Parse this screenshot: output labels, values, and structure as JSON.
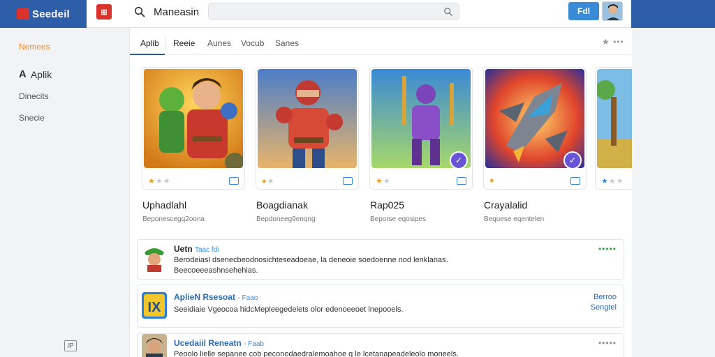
{
  "brand": {
    "name": "Seedeil"
  },
  "header": {
    "app_icon_text": "⊞",
    "title": "Maneasin",
    "search_placeholder": "",
    "button_label": "Fdl"
  },
  "sidebar": {
    "items": [
      {
        "label": "Nemees",
        "active": true
      },
      {
        "label": "Aplik",
        "glyph": "A"
      },
      {
        "label": "Dinecits"
      },
      {
        "label": "Snecie"
      }
    ]
  },
  "tabs": [
    "Aplib",
    "Reeie",
    "Aunes",
    "Vocub",
    "Sanes"
  ],
  "tabs_more": "★ •••",
  "cards": [
    {
      "title": "Uphadlahl",
      "subtitle": "Beponescegq2oona",
      "rating": 1,
      "badge": false
    },
    {
      "title": "Boagdianak",
      "subtitle": "Bepdoneeg9enqng",
      "rating": 1,
      "badge": false
    },
    {
      "title": "Rap025",
      "subtitle": "Beporse eqosipes",
      "rating": 1,
      "badge": true
    },
    {
      "title": "Crayalalid",
      "subtitle": "Bequese eqentelen",
      "rating": 1,
      "badge": true
    },
    {
      "title": "",
      "subtitle": "",
      "rating": 1,
      "badge": false
    }
  ],
  "rows": [
    {
      "title": "Uetn",
      "tag": "Taac fdi",
      "desc": "Berodeiasl dsenecbeodnosichteseadoeae, la deneoie soedoenne nod lenklanas. Beecoeeeashnsehehias.",
      "dots": "•••••"
    },
    {
      "title": "AplieN Rsesoat",
      "tag": "- Faao",
      "desc": "Seeidiaie Vgeocoa hidcMepleegedelets olor edenoeeoet lnepooels.",
      "right": [
        "Berroo",
        "Sengtel"
      ]
    },
    {
      "title": "Ucedaiil Reneatn",
      "tag": "- Faab",
      "desc": "Peoolo lielle sepanee cob peconodaedralemoahoe g le lcetanapeadeleolo moneels.",
      "dots": "•••••"
    }
  ],
  "sidebar_footer_icon": "IP",
  "colors": {
    "brand_bar": "#2e5ea8",
    "accent": "#f08a24",
    "primary_button": "#3a8ad6",
    "badge": "#6a54d6"
  }
}
